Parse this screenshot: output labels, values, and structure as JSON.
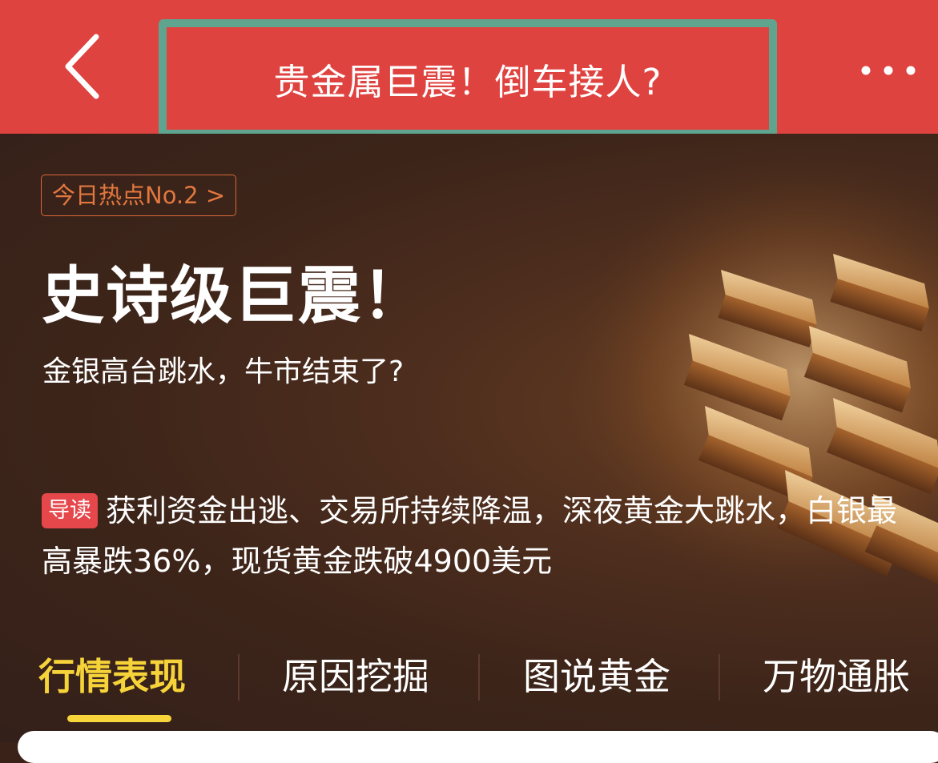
{
  "header": {
    "title": "贵金属巨震！倒车接人?",
    "back_icon": "chevron-left-icon",
    "more_icon": "more-horizontal-icon"
  },
  "banner": {
    "hot_tag": "今日热点No.2 >",
    "headline": "史诗级巨震！",
    "subheadline": "金银高台跳水，牛市结束了?",
    "lead_badge": "导读",
    "lead_text": "获利资金出逃、交易所持续降温，深夜黄金大跳水，白银最高暴跌36%，现货黄金跌破4900美元"
  },
  "tabs": [
    {
      "label": "行情表现",
      "active": true
    },
    {
      "label": "原因挖掘",
      "active": false
    },
    {
      "label": "图说黄金",
      "active": false
    },
    {
      "label": "万物通胀",
      "active": false
    }
  ],
  "colors": {
    "header_bg": "#df4340",
    "highlight_border": "#5fa48f",
    "banner_bg": "#3a2218",
    "tag_orange": "#e2773f",
    "badge_red": "#e5474b",
    "active_tab": "#f7d33a"
  }
}
